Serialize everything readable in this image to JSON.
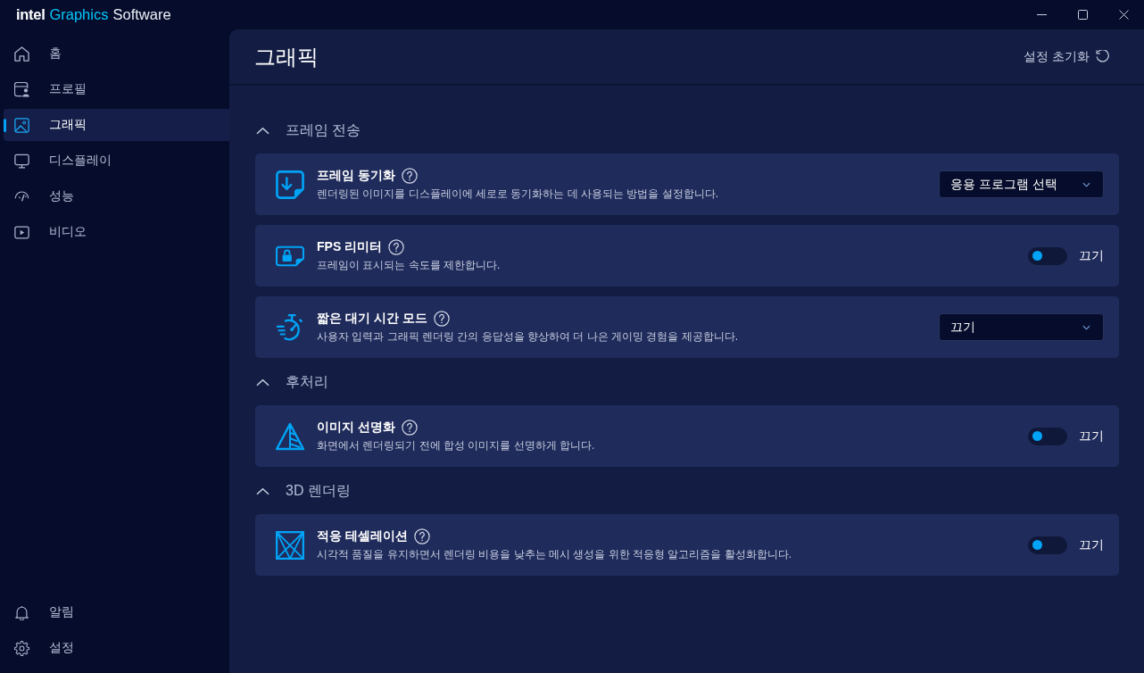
{
  "window": {
    "title": [
      {
        "text": "intel",
        "kind": "logo"
      },
      {
        "text": "Graphics",
        "kind": "accent"
      },
      {
        "text": "Software",
        "kind": "plain"
      }
    ]
  },
  "sidebar": {
    "items": [
      {
        "label": "홈",
        "selected": false
      },
      {
        "label": "프로필",
        "selected": false
      },
      {
        "label": "그래픽",
        "selected": true
      },
      {
        "label": "디스플레이",
        "selected": false
      },
      {
        "label": "성능",
        "selected": false
      },
      {
        "label": "비디오",
        "selected": false
      }
    ],
    "footer_items": [
      {
        "label": "알림",
        "selected": false
      },
      {
        "label": "설정",
        "selected": false
      }
    ]
  },
  "main": {
    "title": "그래픽",
    "reset_label": "설정 초기화",
    "sections": [
      {
        "title": "프레임 전송",
        "expanded": true,
        "settings": [
          {
            "title": "프레임 동기화",
            "description": "렌더링된 이미지를 디스플레이에 세로로 동기화하는 데 사용되는 방법을 설정합니다.",
            "kind": "dropdown",
            "value": "응용 프로그램 선택"
          },
          {
            "title": "FPS 리미터",
            "description": "프레임이 표시되는 속도를 제한합니다.",
            "kind": "toggle",
            "on": false,
            "state_label": "끄기"
          },
          {
            "title": "짧은 대기 시간 모드",
            "description": "사용자 입력과 그래픽 렌더링 간의 응답성을 향상하여 더 나은 게이밍 경험을 제공합니다.",
            "kind": "dropdown",
            "value": "끄기"
          }
        ]
      },
      {
        "title": "후처리",
        "expanded": true,
        "settings": [
          {
            "title": "이미지 선명화",
            "description": "화면에서 렌더링되기 전에 합성 이미지를 선명하게 합니다.",
            "kind": "toggle",
            "on": false,
            "state_label": "끄기"
          }
        ]
      },
      {
        "title": "3D 렌더링",
        "expanded": true,
        "settings": [
          {
            "title": "적응 테셀레이션",
            "description": "시각적 품질을 유지하면서 렌더링 비용을 낮추는 메시 생성을 위한 적응형 알고리즘을 활성화합니다.",
            "kind": "toggle",
            "on": false,
            "state_label": "끄기"
          }
        ]
      }
    ]
  }
}
